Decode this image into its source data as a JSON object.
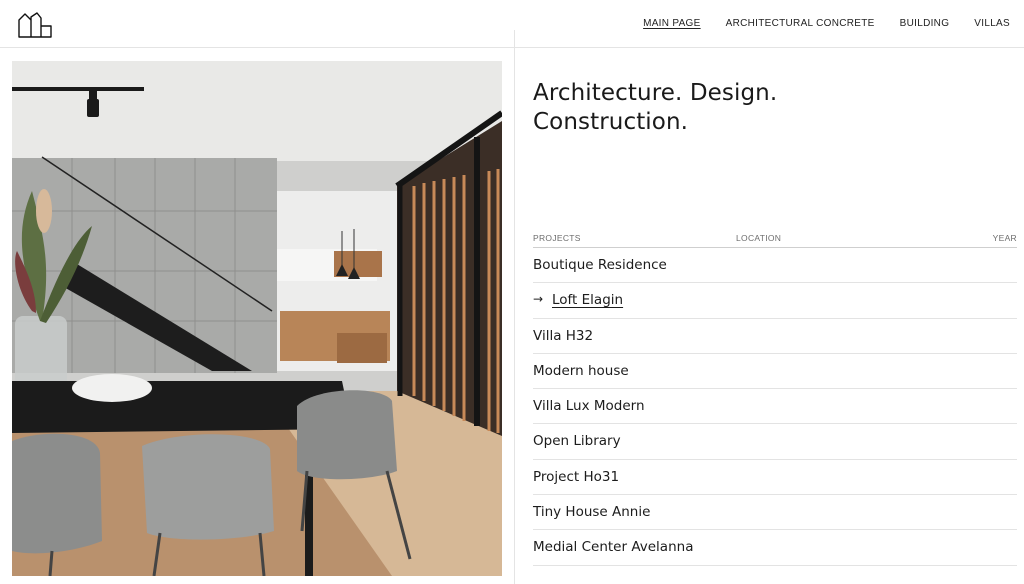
{
  "header": {
    "logo_icon": "building-outline-logo",
    "nav": [
      {
        "label": "MAIN PAGE",
        "active": true
      },
      {
        "label": "ARCHITECTURAL CONCRETE",
        "active": false
      },
      {
        "label": "BUILDING",
        "active": false
      },
      {
        "label": "VILLAS",
        "active": false
      }
    ]
  },
  "hero": {
    "line1": "Architecture. Design.",
    "line2": "Construction."
  },
  "projects_table": {
    "columns": {
      "projects": "PROJECTS",
      "location": "LOCATION",
      "year": "YEAR"
    },
    "active_arrow": "→",
    "rows": [
      "Boutique Residence",
      "Loft Elagin",
      "Villa H32",
      "Modern house",
      "Villa Lux Modern",
      "Open Library",
      "Project Ho31",
      "Tiny House Annie",
      "Medial Center Avelanna"
    ]
  }
}
